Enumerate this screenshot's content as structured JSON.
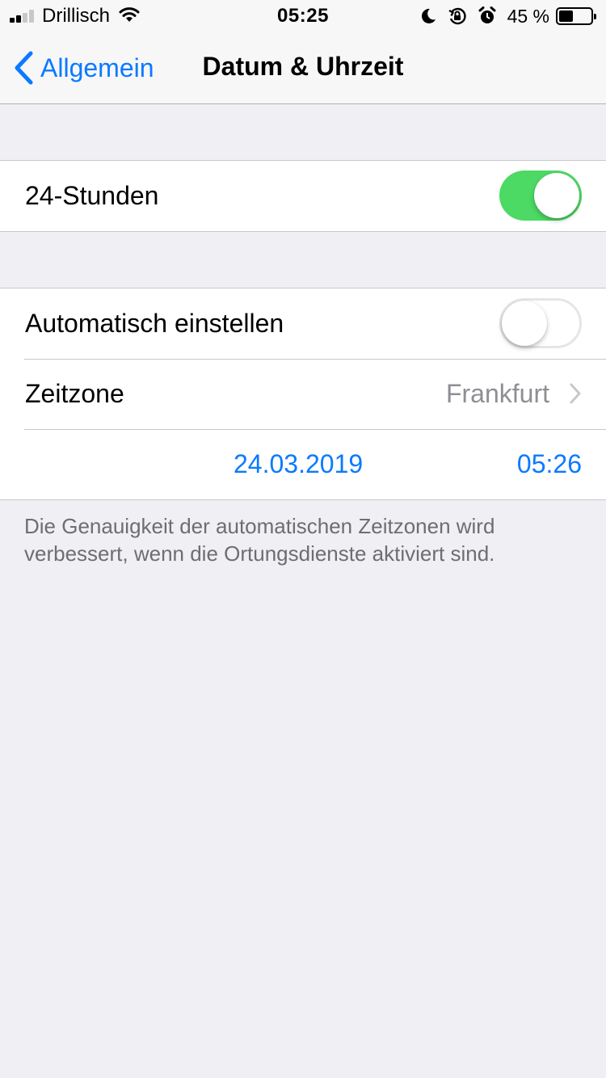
{
  "status_bar": {
    "carrier": "Drillisch",
    "time": "05:25",
    "battery_percent": "45 %",
    "battery_level": 0.45,
    "signal_bars": 2,
    "icons": [
      "wifi-icon",
      "moon-icon",
      "orientation-lock-icon",
      "alarm-icon",
      "battery-icon"
    ]
  },
  "nav": {
    "back_label": "Allgemein",
    "title": "Datum & Uhrzeit"
  },
  "settings": {
    "hours24": {
      "label": "24-Stunden",
      "enabled": true
    },
    "auto_set": {
      "label": "Automatisch einstellen",
      "enabled": false
    },
    "timezone": {
      "label": "Zeitzone",
      "value": "Frankfurt"
    },
    "date": "24.03.2019",
    "time": "05:26"
  },
  "footer_text": "Die Genauigkeit der automatischen Zeitzonen wird verbessert, wenn die Ortungsdienste aktiviert sind.",
  "colors": {
    "accent": "#0a7aff",
    "toggle_on": "#4cd964",
    "background": "#efeff4",
    "secondary_text": "#8e8e93"
  }
}
